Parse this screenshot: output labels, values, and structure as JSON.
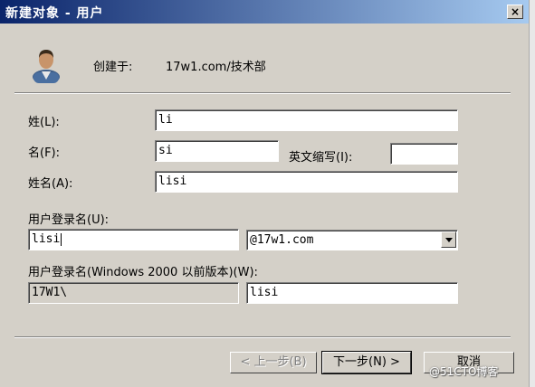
{
  "window": {
    "title": "新建对象 - 用户",
    "close_glyph": "×"
  },
  "header": {
    "created_in_label": "创建于:",
    "created_in_value": "17w1.com/技术部"
  },
  "form": {
    "last_name_label": "姓(L):",
    "last_name_value": "li",
    "first_name_label": "名(F):",
    "first_name_value": "si",
    "initials_label": "英文缩写(I):",
    "initials_value": "",
    "full_name_label": "姓名(A):",
    "full_name_value": "lisi",
    "logon_name_label": "用户登录名(U):",
    "logon_name_value": "lisi",
    "domain_suffix_value": "@17w1.com",
    "pre2000_label": "用户登录名(Windows 2000 以前版本)(W):",
    "pre2000_domain_value": "17W1\\",
    "pre2000_name_value": "lisi"
  },
  "buttons": {
    "back_label": "< 上一步(B)",
    "next_label": "下一步(N) >",
    "cancel_label": "取消"
  },
  "watermark": "@51CTO博客",
  "icons": {
    "user": "user-icon",
    "close": "close-icon",
    "dropdown": "chevron-down-icon"
  }
}
